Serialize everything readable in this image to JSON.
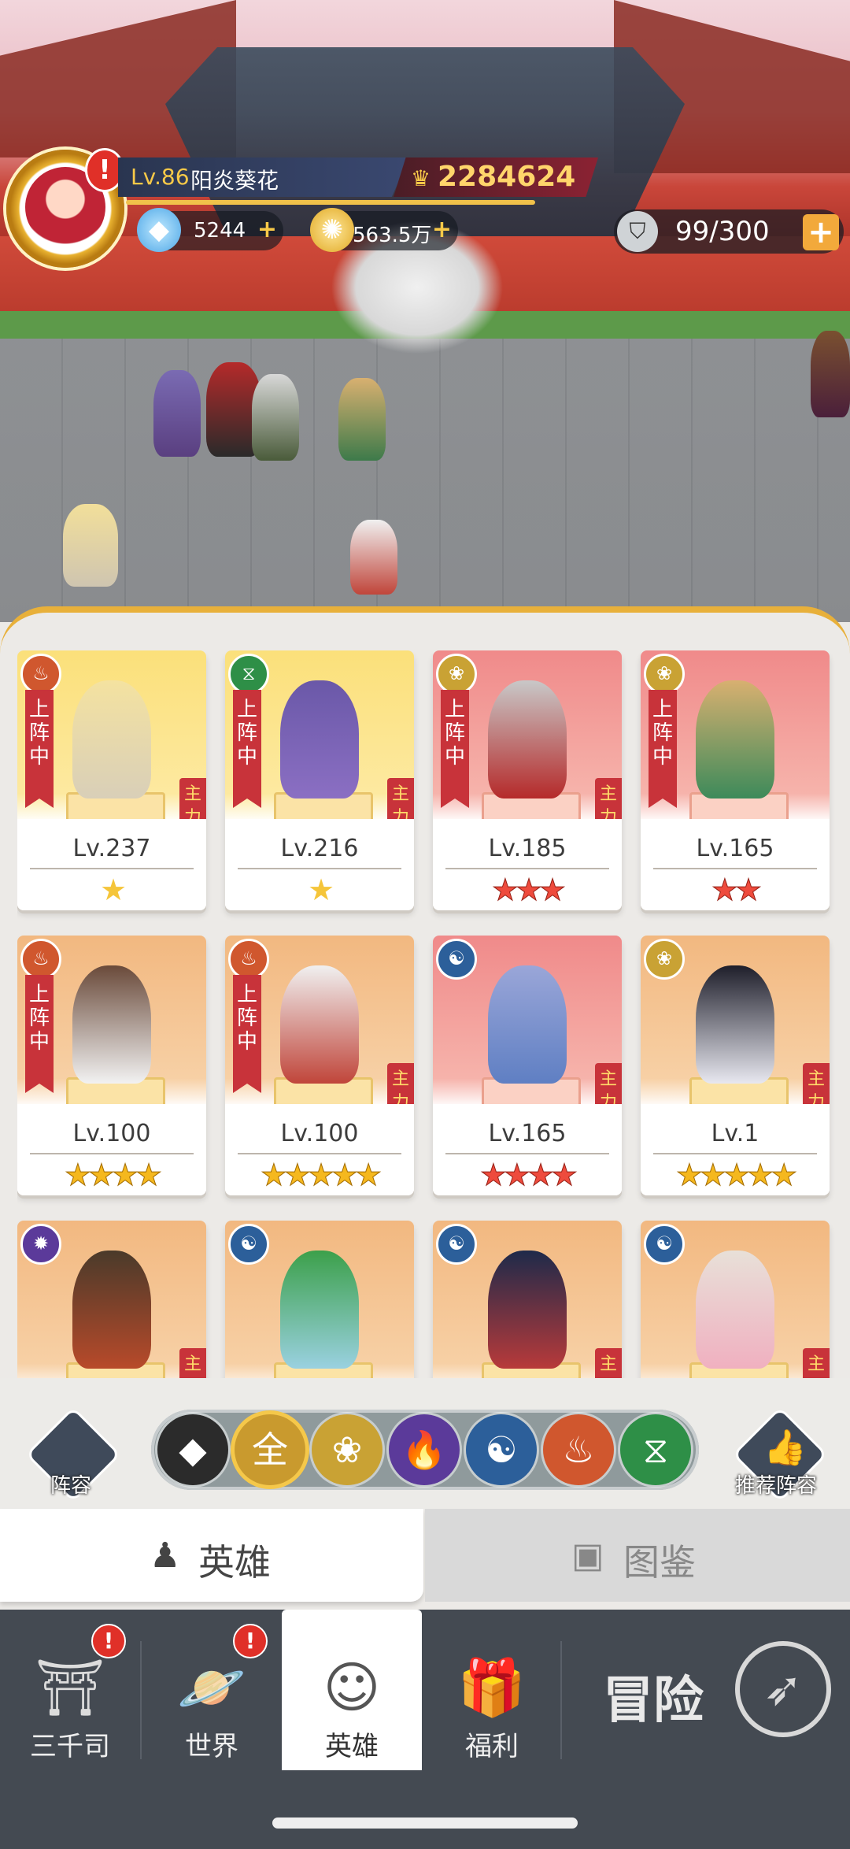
{
  "player": {
    "level": "Lv.86",
    "name": "阳炎葵花",
    "power": "2284624",
    "alert": "!"
  },
  "resources": {
    "diamonds": "5244",
    "gold": "563.5万",
    "stamina": "99/300",
    "plus": "+"
  },
  "heroes": [
    {
      "level": "Lv.237",
      "faction": "monk",
      "on_team": "上阵中",
      "main": "主力",
      "stars": "★",
      "tier": "purple",
      "card": "gold"
    },
    {
      "level": "Lv.216",
      "faction": "dna",
      "on_team": "上阵中",
      "main": "主力",
      "stars": "★",
      "tier": "purple",
      "card": "gold"
    },
    {
      "level": "Lv.185",
      "faction": "lotus",
      "on_team": "上阵中",
      "main": "主力",
      "stars": "★★★",
      "tier": "red",
      "card": "red"
    },
    {
      "level": "Lv.165",
      "faction": "lotus",
      "on_team": "上阵中",
      "main": "",
      "stars": "★★",
      "tier": "red",
      "card": "red"
    },
    {
      "level": "Lv.100",
      "faction": "monk",
      "on_team": "上阵中",
      "main": "",
      "stars": "★★★★",
      "tier": "gold",
      "card": "orange"
    },
    {
      "level": "Lv.100",
      "faction": "monk",
      "on_team": "上阵中",
      "main": "主力",
      "stars": "★★★★★",
      "tier": "gold",
      "card": "orange"
    },
    {
      "level": "Lv.165",
      "faction": "yinyang",
      "on_team": "",
      "main": "主力",
      "stars": "★★★★",
      "tier": "red",
      "card": "red"
    },
    {
      "level": "Lv.1",
      "faction": "lotus",
      "on_team": "",
      "main": "主力",
      "stars": "★★★★★",
      "tier": "gold",
      "card": "orange"
    },
    {
      "level": "",
      "faction": "fire",
      "on_team": "",
      "main": "主",
      "stars": "",
      "tier": "gold",
      "card": "orange"
    },
    {
      "level": "",
      "faction": "yinyang",
      "on_team": "",
      "main": "",
      "stars": "",
      "tier": "gold",
      "card": "orange"
    },
    {
      "level": "",
      "faction": "yinyang",
      "on_team": "",
      "main": "主",
      "stars": "",
      "tier": "gold",
      "card": "orange"
    },
    {
      "level": "",
      "faction": "yinyang",
      "on_team": "",
      "main": "主",
      "stars": "",
      "tier": "gold",
      "card": "orange"
    }
  ],
  "filters": {
    "formation_label": "阵容",
    "recommend_label": "推荐阵容",
    "all_label": "全",
    "buttons": [
      {
        "name": "tank-filter",
        "glyph": "◆",
        "color": "#2b2b2b"
      },
      {
        "name": "all-filter",
        "glyph": "全",
        "color": "#c99a2e"
      },
      {
        "name": "lotus-filter",
        "glyph": "❀",
        "color": "#c9a234"
      },
      {
        "name": "fire-filter",
        "glyph": "🔥",
        "color": "#5b3a9a"
      },
      {
        "name": "yinyang-filter",
        "glyph": "☯",
        "color": "#2c5f9a"
      },
      {
        "name": "monk-filter",
        "glyph": "♨",
        "color": "#d0572e"
      },
      {
        "name": "dna-filter",
        "glyph": "⧖",
        "color": "#2e8f47"
      }
    ]
  },
  "tabs": {
    "heroes": "英雄",
    "atlas": "图鉴"
  },
  "nav": {
    "items": [
      {
        "label": "三千司",
        "badge": "!"
      },
      {
        "label": "世界",
        "badge": "!"
      },
      {
        "label": "英雄",
        "badge": ""
      },
      {
        "label": "福利",
        "badge": ""
      }
    ],
    "adventure": "冒险"
  },
  "colors": {
    "accent_gold": "#e8b03a",
    "on_team_red": "#c8333a",
    "nav_bg": "#444a52"
  }
}
